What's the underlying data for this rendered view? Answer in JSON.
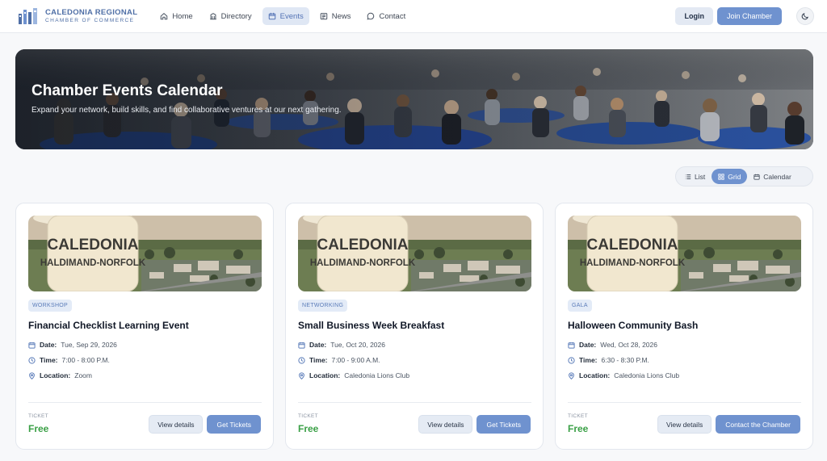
{
  "brand": {
    "name": "CALEDONIA REGIONAL",
    "subtitle": "CHAMBER OF COMMERCE"
  },
  "nav": {
    "items": [
      {
        "label": "Home",
        "icon": "home-icon",
        "active": false
      },
      {
        "label": "Directory",
        "icon": "building-icon",
        "active": false
      },
      {
        "label": "Events",
        "icon": "calendar-icon",
        "active": true
      },
      {
        "label": "News",
        "icon": "newspaper-icon",
        "active": false
      },
      {
        "label": "Contact",
        "icon": "chat-icon",
        "active": false
      }
    ],
    "login_label": "Login",
    "join_label": "Join Chamber",
    "theme_icon": "moon-icon"
  },
  "hero": {
    "title": "Chamber Events Calendar",
    "subtitle": "Expand your network, build skills, and find collaborative ventures at our next gathering."
  },
  "view_toggle": {
    "options": [
      {
        "label": "List",
        "icon": "list-icon",
        "active": false
      },
      {
        "label": "Grid",
        "icon": "grid-icon",
        "active": true
      },
      {
        "label": "Calendar",
        "icon": "calendar-icon",
        "active": false
      }
    ]
  },
  "image_text": {
    "line1": "CALEDONIA",
    "line2": "HALDIMAND-NORFOLK"
  },
  "events": [
    {
      "badge": "WORKSHOP",
      "title": "Financial Checklist Learning Event",
      "date_label": "Date:",
      "date": "Tue, Sep 29, 2026",
      "time_label": "Time:",
      "time": "7:00 - 8:00 P.M.",
      "location_label": "Location:",
      "location": "Zoom",
      "ticket_label": "TICKET",
      "price": "Free",
      "details_label": "View details",
      "action_label": "Get Tickets"
    },
    {
      "badge": "NETWORKING",
      "title": "Small Business Week Breakfast",
      "date_label": "Date:",
      "date": "Tue, Oct 20, 2026",
      "time_label": "Time:",
      "time": "7:00 - 9:00 A.M.",
      "location_label": "Location:",
      "location": "Caledonia Lions Club",
      "ticket_label": "TICKET",
      "price": "Free",
      "details_label": "View details",
      "action_label": "Get Tickets"
    },
    {
      "badge": "GALA",
      "title": "Halloween Community Bash",
      "date_label": "Date:",
      "date": "Wed, Oct 28, 2026",
      "time_label": "Time:",
      "time": "6:30 - 8:30 P.M.",
      "location_label": "Location:",
      "location": "Caledonia Lions Club",
      "ticket_label": "TICKET",
      "price": "Free",
      "details_label": "View details",
      "action_label": "Contact the Chamber"
    }
  ],
  "colors": {
    "accent": "#6f92cf",
    "brand": "#4f6fa6",
    "price": "#3aa046"
  }
}
